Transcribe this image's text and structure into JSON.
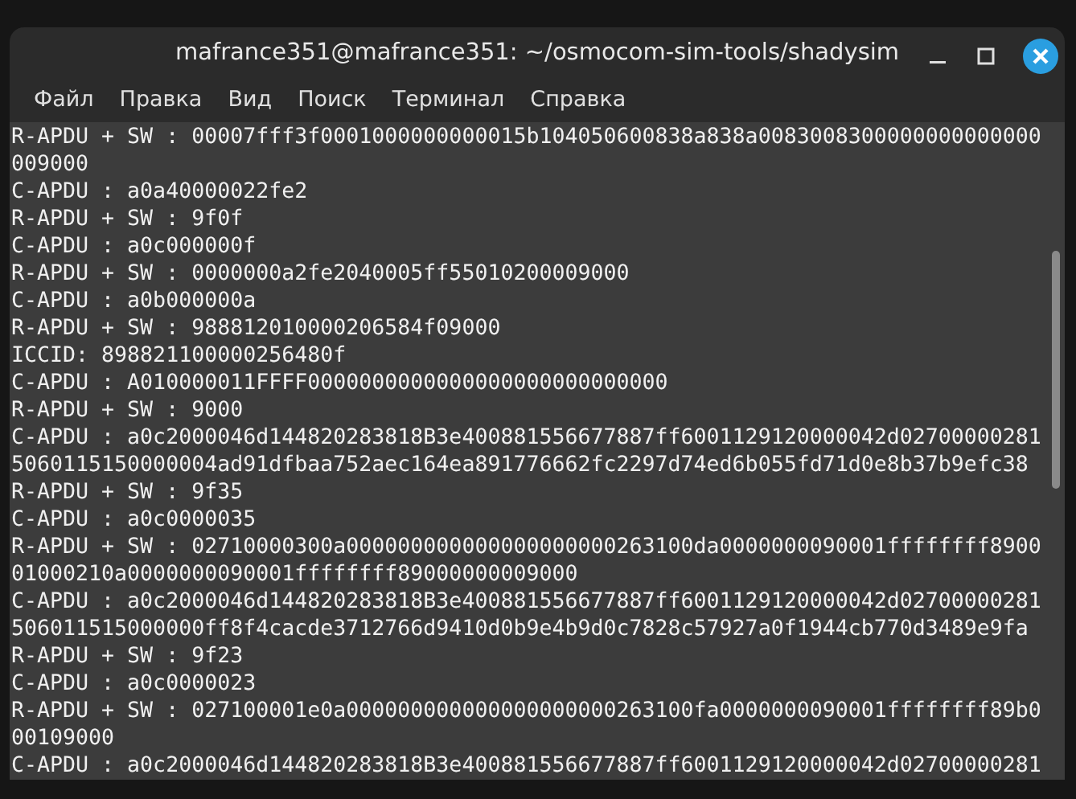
{
  "window": {
    "title": "mafrance351@mafrance351: ~/osmocom-sim-tools/shadysim"
  },
  "menu": [
    "Файл",
    "Правка",
    "Вид",
    "Поиск",
    "Терминал",
    "Справка"
  ],
  "terminal": {
    "lines": [
      "R-APDU + SW : 00007fff3f0001000000000015b104050600838a838a0083008300000000000000",
      "009000",
      "C-APDU : a0a40000022fe2",
      "R-APDU + SW : 9f0f",
      "C-APDU : a0c000000f",
      "R-APDU + SW : 0000000a2fe2040005ff55010200009000",
      "C-APDU : a0b000000a",
      "R-APDU + SW : 988812010000206584f09000",
      "ICCID: 898821100000256480f",
      "C-APDU : A010000011FFFF0000000000000000000000000000",
      "R-APDU + SW : 9000",
      "C-APDU : a0c2000046d144820283818B3e400881556677887ff6001129120000042d02700000281",
      "5060115150000004ad91dfbaa752aec164ea891776662fc2297d74ed6b055fd71d0e8b37b9efc38",
      "R-APDU + SW : 9f35",
      "C-APDU : a0c0000035",
      "R-APDU + SW : 02710000300a000000000000000000000263100da0000000090001ffffffff8900",
      "01000210a0000000090001ffffffff89000000009000",
      "C-APDU : a0c2000046d144820283818B3e400881556677887ff6001129120000042d02700000281",
      "506011515000000ff8f4cacde3712766d9410d0b9e4b9d0c7828c57927a0f1944cb770d3489e9fa",
      "R-APDU + SW : 9f23",
      "C-APDU : a0c0000023",
      "R-APDU + SW : 027100001e0a000000000000000000000263100fa0000000090001ffffffff89b0",
      "00109000",
      "C-APDU : a0c2000046d144820283818B3e400881556677887ff6001129120000042d02700000281"
    ]
  }
}
